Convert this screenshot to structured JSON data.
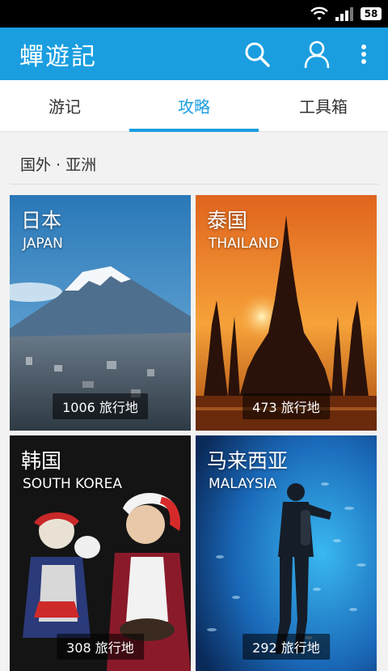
{
  "status": {
    "battery": "58"
  },
  "appbar": {
    "title": "蟬遊記"
  },
  "tabs": [
    {
      "label": "游记"
    },
    {
      "label": "攻略"
    },
    {
      "label": "工具箱"
    }
  ],
  "section": {
    "title": "国外 · 亚洲"
  },
  "destinations": [
    {
      "name_cn": "日本",
      "name_en": "JAPAN",
      "count": "1006 旅行地"
    },
    {
      "name_cn": "泰国",
      "name_en": "THAILAND",
      "count": "473 旅行地"
    },
    {
      "name_cn": "韩国",
      "name_en": "SOUTH KOREA",
      "count": "308 旅行地"
    },
    {
      "name_cn": "马来西亚",
      "name_en": "MALAYSIA",
      "count": "292 旅行地"
    }
  ],
  "colors": {
    "accent": "#1a9ee0"
  }
}
